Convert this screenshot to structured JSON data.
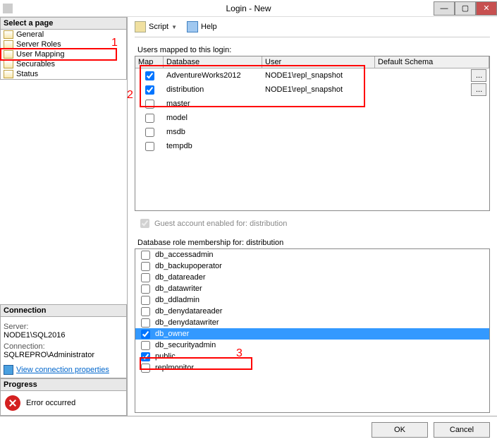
{
  "window": {
    "title": "Login - New"
  },
  "sidebar": {
    "header": "Select a page",
    "items": [
      {
        "label": "General"
      },
      {
        "label": "Server Roles"
      },
      {
        "label": "User Mapping"
      },
      {
        "label": "Securables"
      },
      {
        "label": "Status"
      }
    ]
  },
  "connection": {
    "header": "Connection",
    "server_lbl": "Server:",
    "server_val": "NODE1\\SQL2016",
    "conn_lbl": "Connection:",
    "conn_val": "SQLREPRO\\Administrator",
    "link": "View connection properties"
  },
  "progress": {
    "header": "Progress",
    "status": "Error occurred"
  },
  "toolbar": {
    "script": "Script",
    "help": "Help"
  },
  "mapping": {
    "caption": "Users mapped to this login:",
    "headers": {
      "map": "Map",
      "db": "Database",
      "user": "User",
      "schema": "Default Schema"
    },
    "rows": [
      {
        "checked": true,
        "db": "AdventureWorks2012",
        "user": "NODE1\\repl_snapshot",
        "ellipsis": true
      },
      {
        "checked": true,
        "db": "distribution",
        "user": "NODE1\\repl_snapshot",
        "ellipsis": true
      },
      {
        "checked": false,
        "db": "master",
        "user": "",
        "ellipsis": false
      },
      {
        "checked": false,
        "db": "model",
        "user": "",
        "ellipsis": false
      },
      {
        "checked": false,
        "db": "msdb",
        "user": "",
        "ellipsis": false
      },
      {
        "checked": false,
        "db": "tempdb",
        "user": "",
        "ellipsis": false
      }
    ],
    "guest": "Guest account enabled for: distribution"
  },
  "roles": {
    "caption": "Database role membership for: distribution",
    "items": [
      {
        "name": "db_accessadmin",
        "checked": false,
        "selected": false
      },
      {
        "name": "db_backupoperator",
        "checked": false,
        "selected": false
      },
      {
        "name": "db_datareader",
        "checked": false,
        "selected": false
      },
      {
        "name": "db_datawriter",
        "checked": false,
        "selected": false
      },
      {
        "name": "db_ddladmin",
        "checked": false,
        "selected": false
      },
      {
        "name": "db_denydatareader",
        "checked": false,
        "selected": false
      },
      {
        "name": "db_denydatawriter",
        "checked": false,
        "selected": false
      },
      {
        "name": "db_owner",
        "checked": true,
        "selected": true
      },
      {
        "name": "db_securityadmin",
        "checked": false,
        "selected": false
      },
      {
        "name": "public",
        "checked": true,
        "selected": false
      },
      {
        "name": "replmonitor",
        "checked": false,
        "selected": false
      }
    ]
  },
  "buttons": {
    "ok": "OK",
    "cancel": "Cancel"
  },
  "annotations": {
    "n1": "1",
    "n2": "2",
    "n3": "3"
  }
}
